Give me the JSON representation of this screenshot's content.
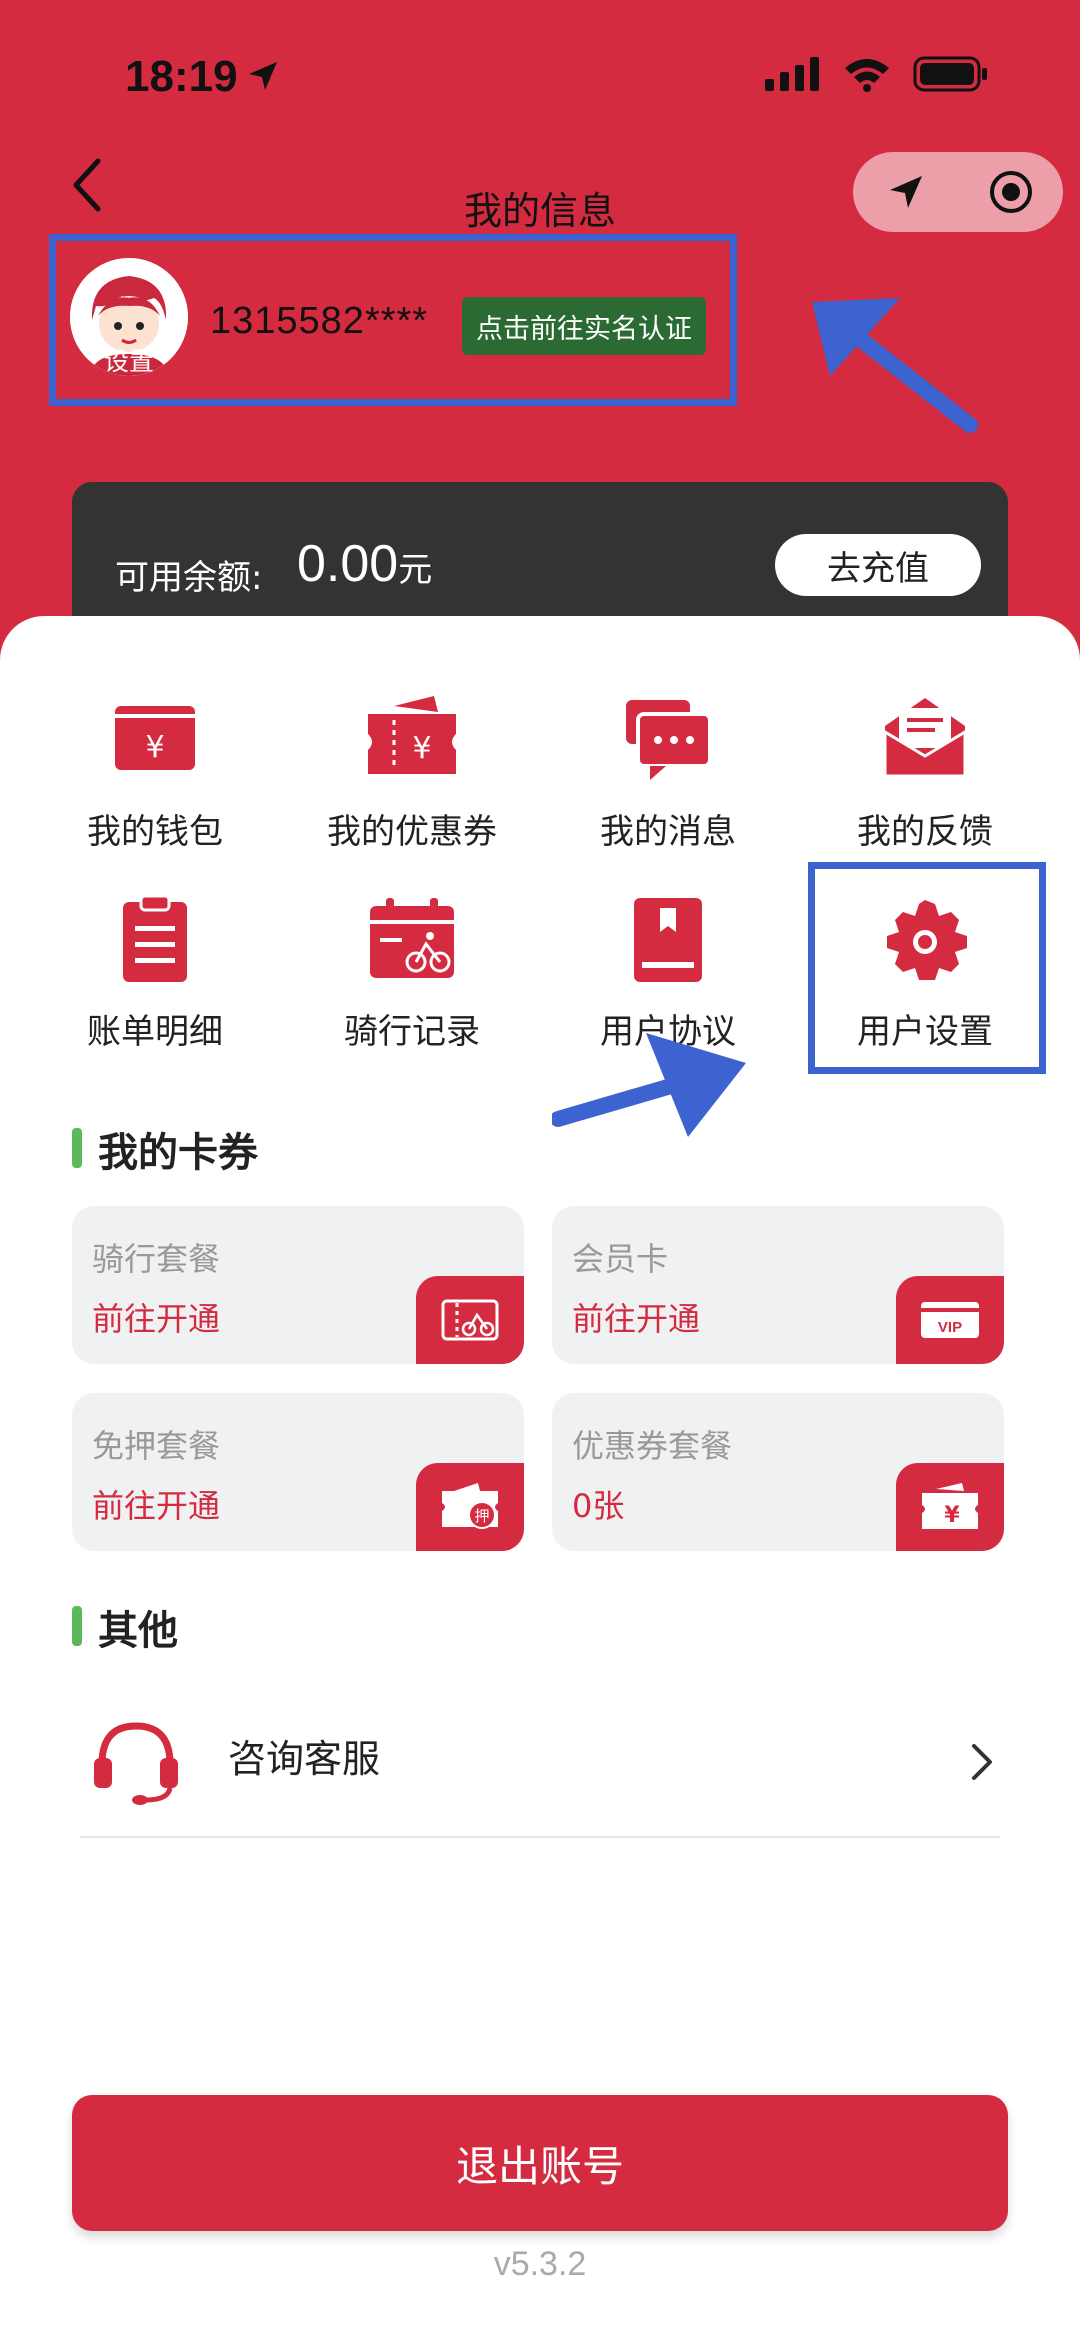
{
  "status_bar": {
    "time": "18:19"
  },
  "nav": {
    "title": "我的信息"
  },
  "profile": {
    "avatar_label": "设置",
    "phone": "1315582****",
    "verify_badge": "点击前往实名认证"
  },
  "balance": {
    "label": "可用余额:",
    "amount": "0.00",
    "unit": "元",
    "recharge_label": "去充值"
  },
  "menu": [
    {
      "label": "我的钱包",
      "icon": "wallet-icon"
    },
    {
      "label": "我的优惠券",
      "icon": "coupon-icon"
    },
    {
      "label": "我的消息",
      "icon": "message-icon"
    },
    {
      "label": "我的反馈",
      "icon": "feedback-icon"
    },
    {
      "label": "账单明细",
      "icon": "bill-icon"
    },
    {
      "label": "骑行记录",
      "icon": "ride-record-icon"
    },
    {
      "label": "用户协议",
      "icon": "agreement-icon"
    },
    {
      "label": "用户设置",
      "icon": "gear-icon"
    }
  ],
  "cards_section": {
    "title": "我的卡券",
    "cards": [
      {
        "title": "骑行套餐",
        "value": "前往开通",
        "icon": "ride-package-icon"
      },
      {
        "title": "会员卡",
        "value": "前往开通",
        "icon": "vip-icon"
      },
      {
        "title": "免押套餐",
        "value": "前往开通",
        "icon": "deposit-free-icon"
      },
      {
        "title": "优惠券套餐",
        "value": "0张",
        "icon": "coupon-package-icon"
      }
    ]
  },
  "other_section": {
    "title": "其他",
    "service_label": "咨询客服"
  },
  "logout_label": "退出账号",
  "version": "v5.3.2",
  "colors": {
    "brand": "#d42b40",
    "dark_card": "#333333",
    "accent_green": "#5bb95b",
    "annotation_blue": "#3d63d1"
  }
}
